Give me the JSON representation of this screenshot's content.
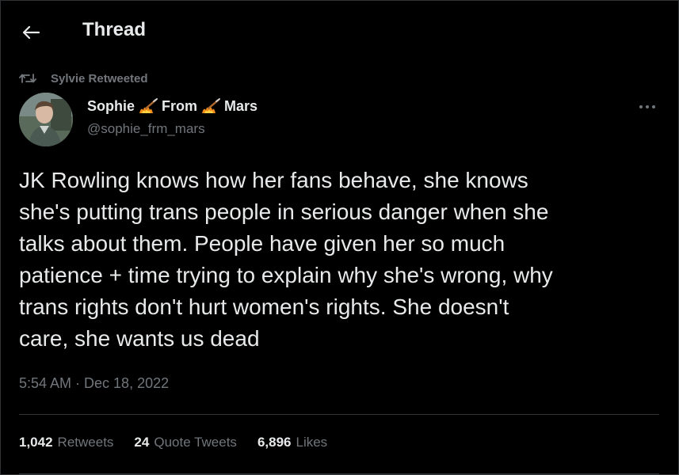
{
  "header": {
    "title": "Thread",
    "back_icon": "arrow-left-icon"
  },
  "tweet": {
    "social_context": {
      "icon": "retweet-icon",
      "text": "Sylvie Retweeted"
    },
    "author": {
      "name_parts": [
        "Sophie",
        "From",
        "Mars"
      ],
      "name_emoji": "guitar-fire-emoji",
      "handle": "@sophie_frm_mars"
    },
    "more_icon": "more-horizontal-icon",
    "text": "JK Rowling knows how her fans behave, she knows\nshe's putting trans people in serious danger when she\ntalks about them. People have given her so much\npatience + time trying to explain why she's wrong, why\ntrans rights don't hurt women's rights. She doesn't\ncare, she wants us dead",
    "timestamp": "5:54 AM · Dec 18, 2022",
    "stats": {
      "retweets": {
        "count": "1,042",
        "label": "Retweets"
      },
      "quotes": {
        "count": "24",
        "label": "Quote Tweets"
      },
      "likes": {
        "count": "6,896",
        "label": "Likes"
      }
    }
  },
  "colors": {
    "background": "#000000",
    "text_primary": "#e7e9ea",
    "text_secondary": "#71767b",
    "divider": "#2f3336"
  }
}
